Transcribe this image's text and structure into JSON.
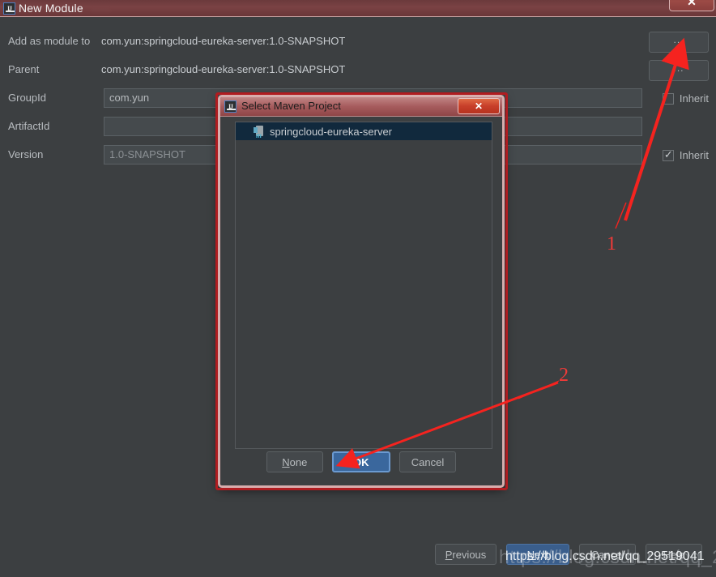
{
  "window": {
    "title": "New Module",
    "ghost_title": "......",
    "close_label": "✕"
  },
  "form": {
    "rows": [
      {
        "label": "Add as module to",
        "value": "com.yun:springcloud-eureka-server:1.0-SNAPSHOT",
        "type": "text"
      },
      {
        "label": "Parent",
        "value": "com.yun:springcloud-eureka-server:1.0-SNAPSHOT",
        "type": "text"
      },
      {
        "label": "GroupId",
        "value": "com.yun",
        "type": "input"
      },
      {
        "label": "ArtifactId",
        "value": "",
        "type": "input"
      },
      {
        "label": "Version",
        "value": "1.0-SNAPSHOT",
        "type": "input"
      }
    ],
    "browse_button_label": "...",
    "inherit_label": "Inherit",
    "inherit_groupid_checked": false,
    "inherit_version_checked": true
  },
  "wizard_buttons": {
    "previous": "Previous",
    "next": "Next",
    "cancel": "Cancel",
    "help": "Help"
  },
  "maven_dialog": {
    "title": "Select Maven Project",
    "close_label": "✕",
    "list": [
      {
        "label": "springcloud-eureka-server",
        "icon": "maven-project-icon",
        "selected": true
      }
    ],
    "buttons": {
      "none": "None",
      "none_mnemonic": "N",
      "ok": "OK",
      "cancel": "Cancel"
    }
  },
  "annotations": {
    "marker_one": "1",
    "marker_two": "2",
    "highlight_color": "#b01c20",
    "arrow_color": "#f5231f"
  },
  "watermark": {
    "url": "https://blog.csdn.net/qq_29519041"
  }
}
